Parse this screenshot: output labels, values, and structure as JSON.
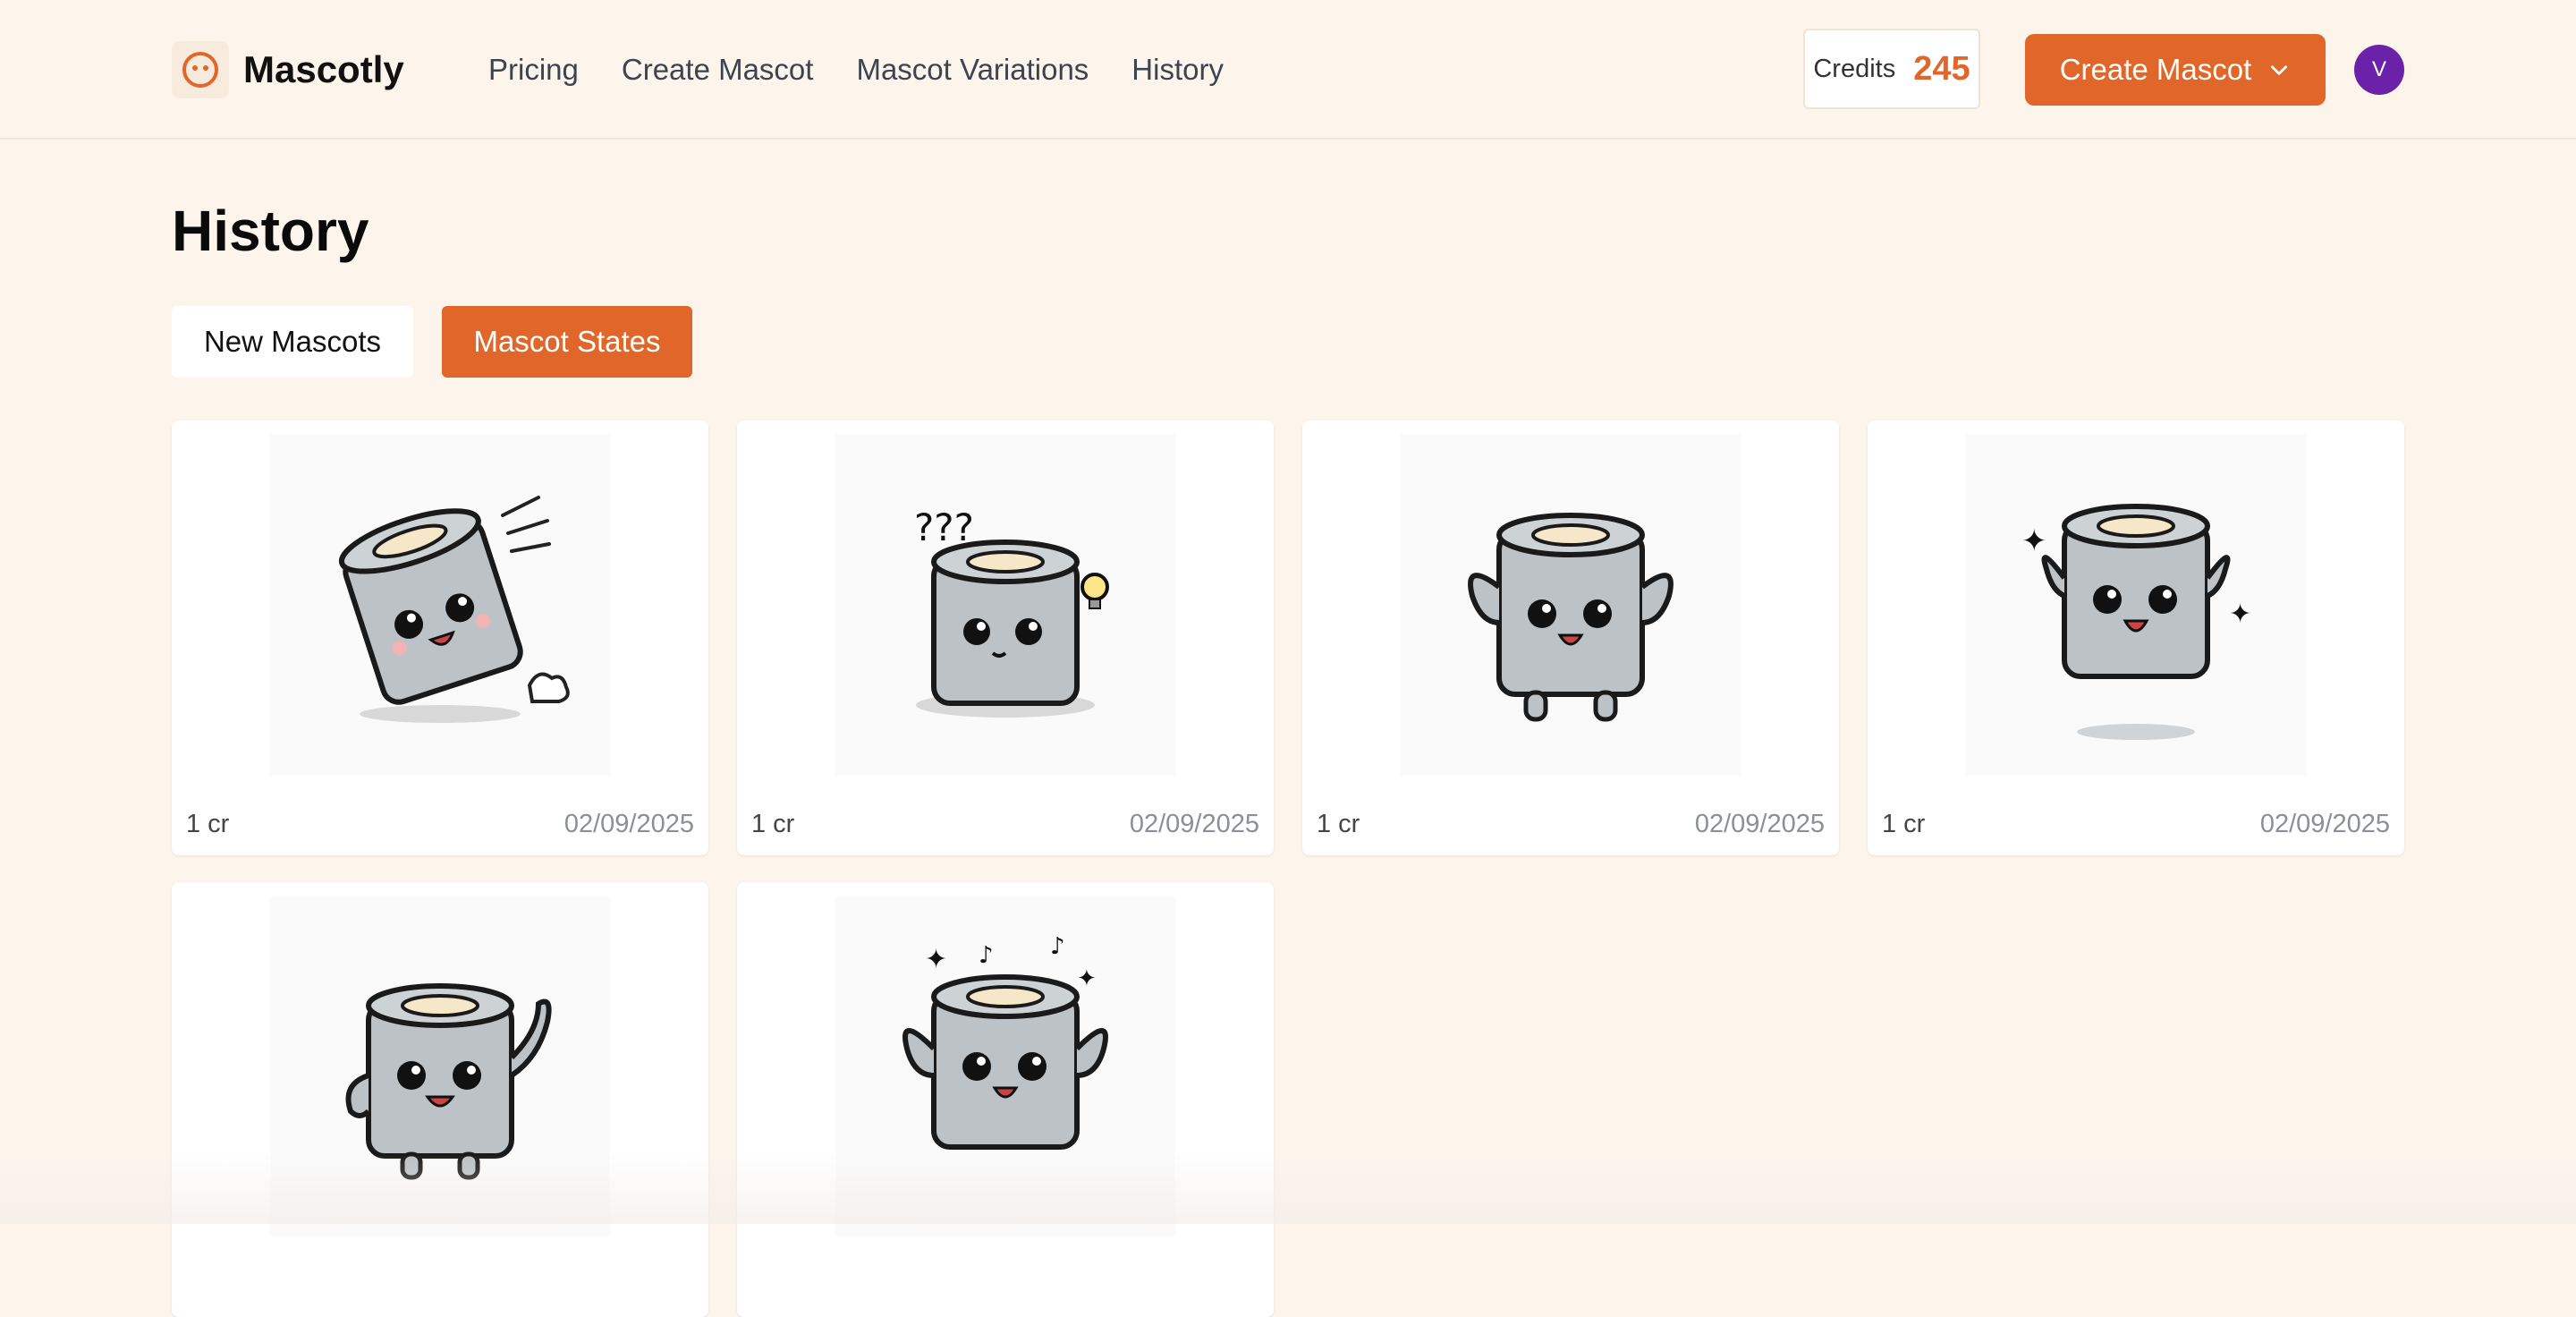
{
  "header": {
    "brand": "Mascotly",
    "logo_icon": "mascot-face-icon",
    "nav": [
      {
        "label": "Pricing"
      },
      {
        "label": "Create Mascot"
      },
      {
        "label": "Mascot Variations"
      },
      {
        "label": "History"
      }
    ],
    "credits_label": "Credits",
    "credits_value": "245",
    "create_button_label": "Create Mascot",
    "create_button_icon": "chevron-down-icon",
    "avatar_initial": "V"
  },
  "page": {
    "title": "History",
    "tabs": [
      {
        "label": "New Mascots",
        "active": false
      },
      {
        "label": "Mascot States",
        "active": true
      }
    ]
  },
  "cards": [
    {
      "image": "mascot-running-icon",
      "cost": "1 cr",
      "date": "02/09/2025"
    },
    {
      "image": "mascot-thinking-icon",
      "cost": "1 cr",
      "date": "02/09/2025"
    },
    {
      "image": "mascot-happy-icon",
      "cost": "1 cr",
      "date": "02/09/2025"
    },
    {
      "image": "mascot-jumping-icon",
      "cost": "1 cr",
      "date": "02/09/2025"
    },
    {
      "image": "mascot-waving-icon"
    },
    {
      "image": "mascot-dancing-icon"
    }
  ],
  "colors": {
    "background": "#fdf5ec",
    "accent": "#e0662a",
    "avatar": "#6b21a8",
    "muted_text": "#8a8f98"
  }
}
